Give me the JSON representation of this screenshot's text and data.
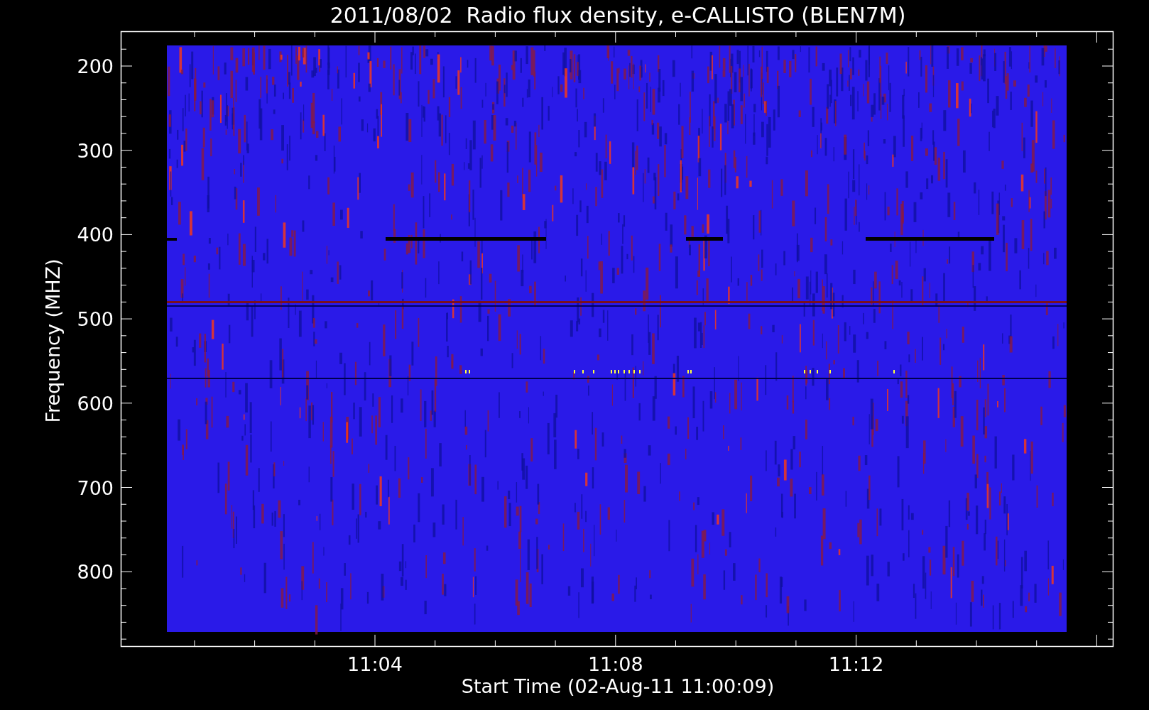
{
  "title": "2011/08/02  Radio flux density, e-CALLISTO (BLEN7M)",
  "y_axis": {
    "label": "Frequency (MHZ)",
    "ticks": [
      "200",
      "300",
      "400",
      "500",
      "600",
      "700",
      "800"
    ]
  },
  "x_axis": {
    "label": "Start Time (02-Aug-11 11:00:09)",
    "ticks": [
      "11:04",
      "11:08",
      "11:12"
    ]
  }
}
